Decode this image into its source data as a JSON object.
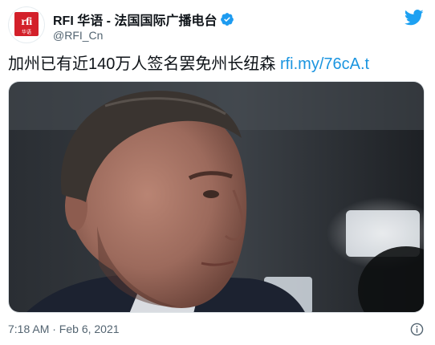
{
  "account": {
    "name": "RFI 华语 - 法国国际广播电台",
    "handle": "@RFI_Cn",
    "avatar_logo": "rfi",
    "avatar_sub": "华语",
    "verified_icon": "verified-badge-icon",
    "verified_color": "#1d9bf0"
  },
  "tweet": {
    "text": "加州已有近140万人签名罢免州长纽森",
    "link": "rfi.my/76cA.t",
    "link_color": "#1b95e0",
    "image_alt": "photo"
  },
  "footer": {
    "timestamp": "7:18 AM · Feb 6, 2021",
    "info_icon": "info-icon"
  },
  "brand": {
    "twitter_icon": "twitter-bird-icon",
    "twitter_color": "#1da1f2",
    "rfi_red": "#d3202a"
  }
}
